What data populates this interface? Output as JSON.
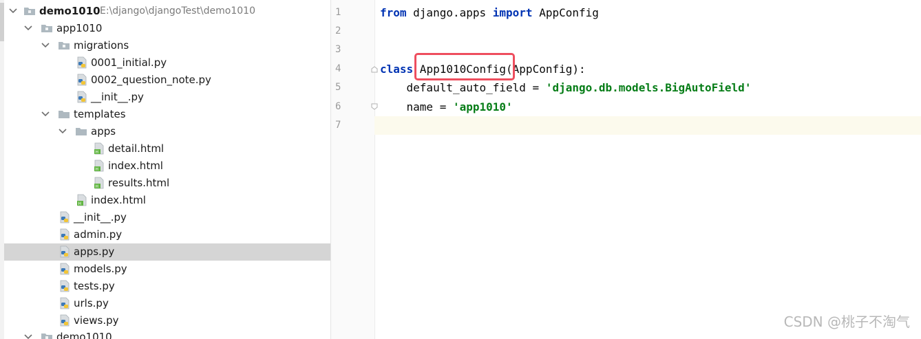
{
  "project_tree": {
    "root": {
      "name": "demo1010",
      "path": "E:\\django\\djangoTest\\demo1010"
    },
    "rows": [
      {
        "label": "demo1010",
        "type": "root",
        "expanded": true
      },
      {
        "label": "app1010",
        "type": "package",
        "expanded": true
      },
      {
        "label": "migrations",
        "type": "package",
        "expanded": true
      },
      {
        "label": "0001_initial.py",
        "type": "python"
      },
      {
        "label": "0002_question_note.py",
        "type": "python"
      },
      {
        "label": "__init__.py",
        "type": "python"
      },
      {
        "label": "templates",
        "type": "folder",
        "expanded": true
      },
      {
        "label": "apps",
        "type": "folder",
        "expanded": true
      },
      {
        "label": "detail.html",
        "type": "html"
      },
      {
        "label": "index.html",
        "type": "html"
      },
      {
        "label": "results.html",
        "type": "html"
      },
      {
        "label": "index.html",
        "type": "html"
      },
      {
        "label": "__init__.py",
        "type": "python"
      },
      {
        "label": "admin.py",
        "type": "python"
      },
      {
        "label": "apps.py",
        "type": "python",
        "selected": true
      },
      {
        "label": "models.py",
        "type": "python"
      },
      {
        "label": "tests.py",
        "type": "python"
      },
      {
        "label": "urls.py",
        "type": "python"
      },
      {
        "label": "views.py",
        "type": "python"
      },
      {
        "label": "demo1010",
        "type": "package",
        "expanded": true
      }
    ]
  },
  "editor": {
    "line_numbers": [
      "1",
      "2",
      "3",
      "4",
      "5",
      "6",
      "7"
    ],
    "current_line": "7",
    "lines": {
      "l1": {
        "kw1": "from",
        "mid": " django.apps ",
        "kw2": "import",
        "end": " AppConfig"
      },
      "l4": {
        "kw": "class",
        "name": " App1010Config",
        "rest": "(AppConfig):"
      },
      "l5": {
        "pre": "    default_auto_field = ",
        "str": "'django.db.models.BigAutoField'"
      },
      "l6": {
        "pre": "    name = ",
        "str": "'app1010'"
      }
    },
    "highlighted_identifier": "App1010Config"
  },
  "watermark": "CSDN @桃子不淘气",
  "colors": {
    "keyword": "#0033b3",
    "string": "#067d17",
    "selection": "#d5d5d5",
    "highlight_box": "#ee4e5e",
    "current_line_bg": "#fcfaed"
  }
}
